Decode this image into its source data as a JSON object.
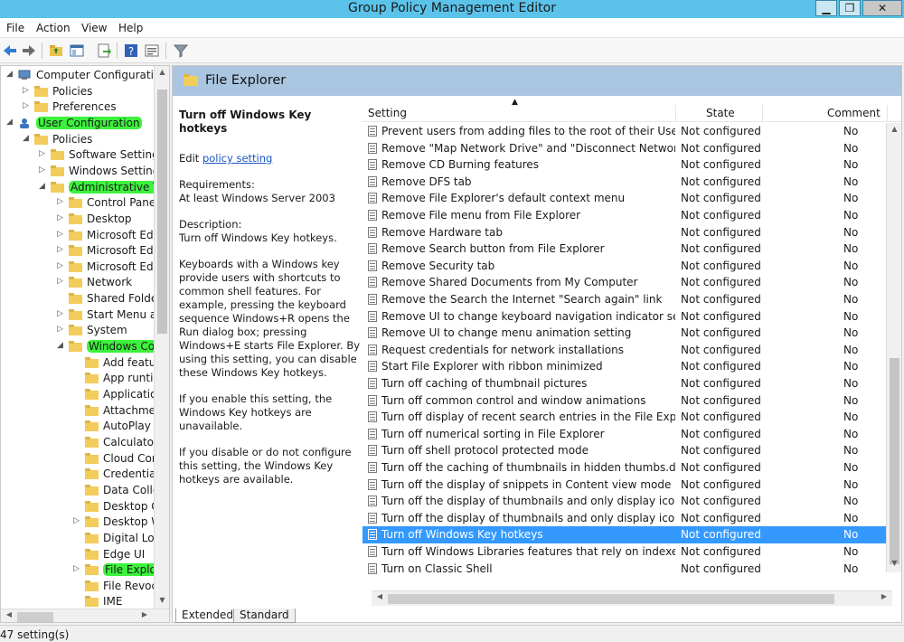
{
  "window": {
    "title": "Group Policy Management Editor",
    "minimize": "▁",
    "restore": "❐",
    "close": "✕"
  },
  "menu": [
    "File",
    "Action",
    "View",
    "Help"
  ],
  "tree": {
    "items": [
      {
        "label": "Computer Configuration",
        "level": 0,
        "expander": "◢",
        "icon": "computer-icon"
      },
      {
        "label": "Policies",
        "level": 1,
        "expander": "▷",
        "icon": "folder-icon"
      },
      {
        "label": "Preferences",
        "level": 1,
        "expander": "▷",
        "icon": "folder-icon"
      },
      {
        "label": "User Configuration",
        "level": 0,
        "expander": "◢",
        "icon": "user-icon",
        "highlight": true
      },
      {
        "label": "Policies",
        "level": 1,
        "expander": "◢",
        "icon": "folder-icon"
      },
      {
        "label": "Software Settings",
        "level": 2,
        "expander": "▷",
        "icon": "folder-icon"
      },
      {
        "label": "Windows Settings",
        "level": 2,
        "expander": "▷",
        "icon": "folder-icon"
      },
      {
        "label": "Administrative Te",
        "level": 2,
        "expander": "◢",
        "icon": "folder-icon",
        "highlight": true
      },
      {
        "label": "Control Panel",
        "level": 3,
        "expander": "▷",
        "icon": "folder-icon"
      },
      {
        "label": "Desktop",
        "level": 3,
        "expander": "▷",
        "icon": "folder-icon"
      },
      {
        "label": "Microsoft Edg",
        "level": 3,
        "expander": "▷",
        "icon": "folder-icon"
      },
      {
        "label": "Microsoft Edg",
        "level": 3,
        "expander": "▷",
        "icon": "folder-icon"
      },
      {
        "label": "Microsoft Edg",
        "level": 3,
        "expander": "▷",
        "icon": "folder-icon"
      },
      {
        "label": "Network",
        "level": 3,
        "expander": "▷",
        "icon": "folder-icon"
      },
      {
        "label": "Shared Folder",
        "level": 3,
        "expander": "",
        "icon": "folder-icon"
      },
      {
        "label": "Start Menu an",
        "level": 3,
        "expander": "▷",
        "icon": "folder-icon"
      },
      {
        "label": "System",
        "level": 3,
        "expander": "▷",
        "icon": "folder-icon"
      },
      {
        "label": "Windows Con",
        "level": 3,
        "expander": "◢",
        "icon": "folder-icon",
        "highlight": true
      },
      {
        "label": "Add featur",
        "level": 4,
        "expander": "",
        "icon": "folder-icon"
      },
      {
        "label": "App runtir",
        "level": 4,
        "expander": "",
        "icon": "folder-icon"
      },
      {
        "label": "Applicatio",
        "level": 4,
        "expander": "",
        "icon": "folder-icon"
      },
      {
        "label": "Attachmer",
        "level": 4,
        "expander": "",
        "icon": "folder-icon"
      },
      {
        "label": "AutoPlay F",
        "level": 4,
        "expander": "",
        "icon": "folder-icon"
      },
      {
        "label": "Calculator",
        "level": 4,
        "expander": "",
        "icon": "folder-icon"
      },
      {
        "label": "Cloud Cor",
        "level": 4,
        "expander": "",
        "icon": "folder-icon"
      },
      {
        "label": "Credential",
        "level": 4,
        "expander": "",
        "icon": "folder-icon"
      },
      {
        "label": "Data Colle",
        "level": 4,
        "expander": "",
        "icon": "folder-icon"
      },
      {
        "label": "Desktop G",
        "level": 4,
        "expander": "",
        "icon": "folder-icon"
      },
      {
        "label": "Desktop W",
        "level": 4,
        "expander": "▷",
        "icon": "folder-icon"
      },
      {
        "label": "Digital Loc",
        "level": 4,
        "expander": "",
        "icon": "folder-icon"
      },
      {
        "label": "Edge UI",
        "level": 4,
        "expander": "",
        "icon": "folder-icon"
      },
      {
        "label": "File Explor",
        "level": 4,
        "expander": "▷",
        "icon": "folder-icon",
        "highlight": true
      },
      {
        "label": "File Revoc",
        "level": 4,
        "expander": "",
        "icon": "folder-icon"
      },
      {
        "label": "IME",
        "level": 4,
        "expander": "",
        "icon": "folder-icon"
      }
    ]
  },
  "content": {
    "header_title": "File Explorer",
    "description": {
      "title": "Turn off Windows Key hotkeys",
      "edit_prefix": "Edit ",
      "edit_link": "policy setting ",
      "requirements_label": "Requirements:",
      "requirements_value": "At least Windows Server 2003",
      "description_label": "Description:",
      "description_value": "Turn off Windows Key hotkeys.",
      "para1": "Keyboards with a Windows key provide users with shortcuts to common shell features. For example, pressing the keyboard sequence Windows+R opens the Run dialog box; pressing Windows+E starts File Explorer. By using this setting, you can disable these Windows Key hotkeys.",
      "para2": "If you enable this setting, the Windows Key hotkeys are unavailable.",
      "para3": "If you disable or do not configure this setting, the Windows Key hotkeys are available."
    },
    "columns": {
      "setting": "Setting",
      "state": "State",
      "comment": "Comment",
      "sort_glyph": "▲"
    },
    "rows": [
      {
        "setting": "Prevent users from adding files to the root of their Users File...",
        "state": "Not configured",
        "comment": "No"
      },
      {
        "setting": "Remove \"Map Network Drive\" and \"Disconnect Network Dri...",
        "state": "Not configured",
        "comment": "No"
      },
      {
        "setting": "Remove CD Burning features",
        "state": "Not configured",
        "comment": "No"
      },
      {
        "setting": "Remove DFS tab",
        "state": "Not configured",
        "comment": "No"
      },
      {
        "setting": "Remove File Explorer's default context menu",
        "state": "Not configured",
        "comment": "No"
      },
      {
        "setting": "Remove File menu from File Explorer",
        "state": "Not configured",
        "comment": "No"
      },
      {
        "setting": "Remove Hardware tab",
        "state": "Not configured",
        "comment": "No"
      },
      {
        "setting": "Remove Search button from File Explorer",
        "state": "Not configured",
        "comment": "No"
      },
      {
        "setting": "Remove Security tab",
        "state": "Not configured",
        "comment": "No"
      },
      {
        "setting": "Remove Shared Documents from My Computer",
        "state": "Not configured",
        "comment": "No"
      },
      {
        "setting": "Remove the Search the Internet \"Search again\" link",
        "state": "Not configured",
        "comment": "No"
      },
      {
        "setting": "Remove UI to change keyboard navigation indicator setting",
        "state": "Not configured",
        "comment": "No"
      },
      {
        "setting": "Remove UI to change menu animation setting",
        "state": "Not configured",
        "comment": "No"
      },
      {
        "setting": "Request credentials for network installations",
        "state": "Not configured",
        "comment": "No"
      },
      {
        "setting": "Start File Explorer with ribbon minimized",
        "state": "Not configured",
        "comment": "No"
      },
      {
        "setting": "Turn off caching of thumbnail pictures",
        "state": "Not configured",
        "comment": "No"
      },
      {
        "setting": "Turn off common control and window animations",
        "state": "Not configured",
        "comment": "No"
      },
      {
        "setting": "Turn off display of recent search entries in the File Explorer s...",
        "state": "Not configured",
        "comment": "No"
      },
      {
        "setting": "Turn off numerical sorting in File Explorer",
        "state": "Not configured",
        "comment": "No"
      },
      {
        "setting": "Turn off shell protocol protected mode",
        "state": "Not configured",
        "comment": "No"
      },
      {
        "setting": "Turn off the caching of thumbnails in hidden thumbs.db files",
        "state": "Not configured",
        "comment": "No"
      },
      {
        "setting": "Turn off the display of snippets in Content view mode",
        "state": "Not configured",
        "comment": "No"
      },
      {
        "setting": "Turn off the display of thumbnails and only display icons on...",
        "state": "Not configured",
        "comment": "No"
      },
      {
        "setting": "Turn off the display of thumbnails and only display icons.",
        "state": "Not configured",
        "comment": "No"
      },
      {
        "setting": "Turn off Windows Key hotkeys",
        "state": "Not configured",
        "comment": "No",
        "selected": true
      },
      {
        "setting": "Turn off Windows Libraries features that rely on indexed file ...",
        "state": "Not configured",
        "comment": "No"
      },
      {
        "setting": "Turn on Classic Shell",
        "state": "Not configured",
        "comment": "No"
      }
    ],
    "tabs": [
      "Extended",
      "Standard"
    ]
  },
  "status": {
    "text": "47 setting(s)"
  },
  "colors": {
    "titlebar": "#5bc3ea",
    "header_band": "#a9c5e0",
    "selection": "#3399ff",
    "highlight": "#3cf23c"
  }
}
